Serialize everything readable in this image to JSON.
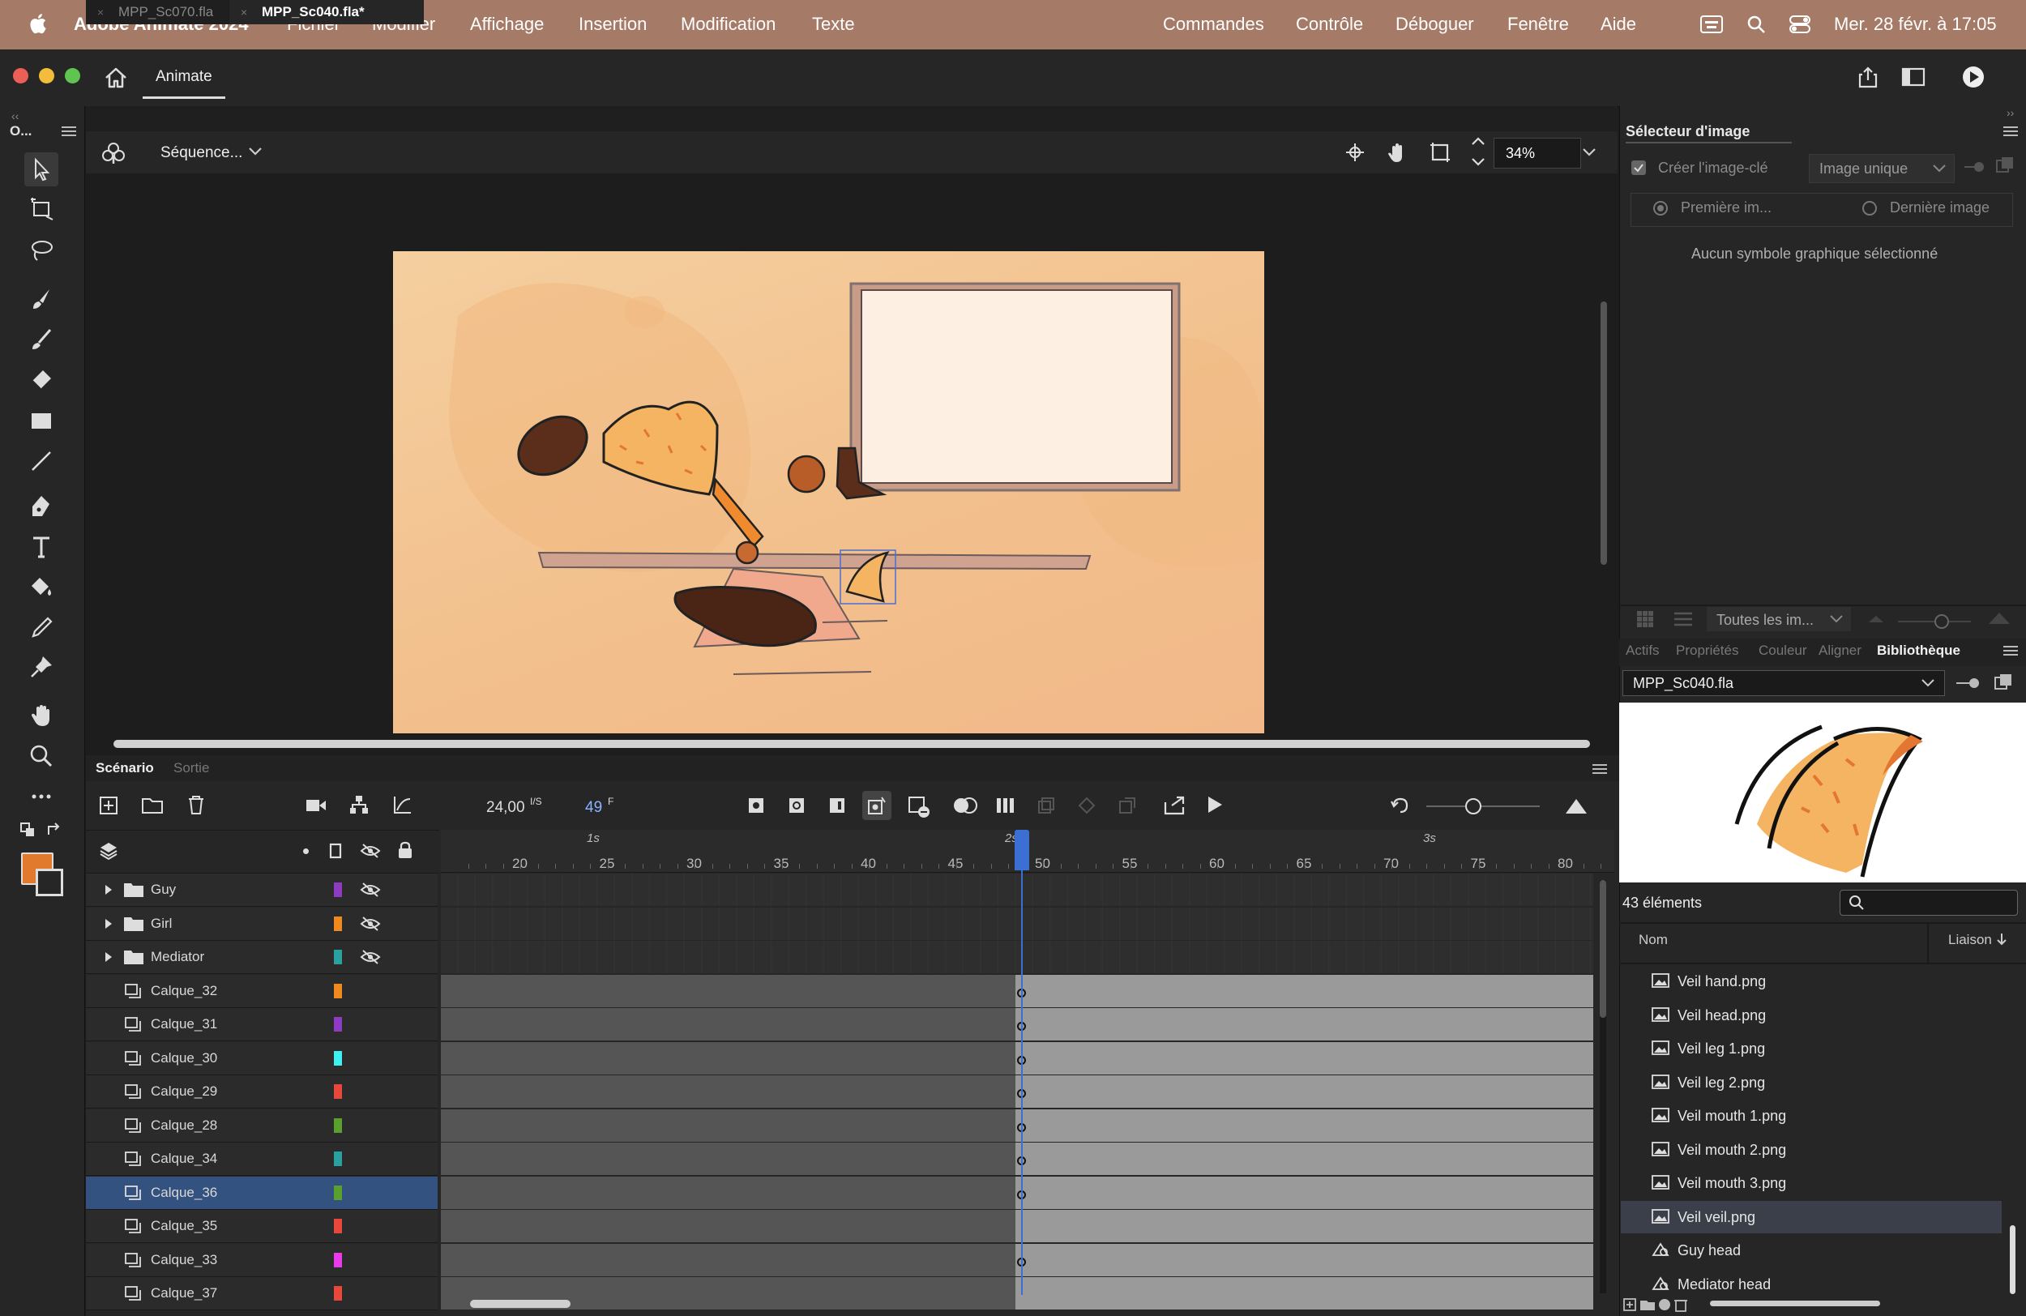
{
  "menubar": {
    "app_name": "Adobe Animate 2024",
    "items": [
      "Fichier",
      "Modifier",
      "Affichage",
      "Insertion",
      "Modification",
      "Texte",
      "Commandes",
      "Contrôle",
      "Déboguer",
      "Fenêtre",
      "Aide"
    ],
    "datetime": "Mer. 28 févr. à 17:05"
  },
  "appbar": {
    "tab_label": "Animate"
  },
  "toolbar": {
    "header": "O..."
  },
  "doc_tabs": [
    {
      "label": "MPP_Sc070.fla",
      "active": false
    },
    {
      "label": "MPP_Sc040.fla*",
      "active": true
    }
  ],
  "editbar": {
    "scene_label": "Séquence...",
    "zoom": "34%"
  },
  "frame_picker": {
    "title": "Sélecteur d'image",
    "create_keyframe": "Créer l'image-clé",
    "mode": "Image unique",
    "first_frame": "Première im...",
    "last_frame": "Dernière image",
    "empty_message": "Aucun symbole graphique sélectionné",
    "filter": "Toutes les im..."
  },
  "panel_tabs": [
    "Actifs",
    "Propriétés",
    "Couleur",
    "Aligner",
    "Bibliothèque"
  ],
  "library": {
    "file": "MPP_Sc040.fla",
    "count": "43 éléments",
    "col_name": "Nom",
    "col_link": "Liaison",
    "items": [
      {
        "label": "Veil hand.png",
        "type": "bitmap",
        "selected": false
      },
      {
        "label": "Veil head.png",
        "type": "bitmap",
        "selected": false
      },
      {
        "label": "Veil leg 1.png",
        "type": "bitmap",
        "selected": false
      },
      {
        "label": "Veil leg 2.png",
        "type": "bitmap",
        "selected": false
      },
      {
        "label": "Veil mouth 1.png",
        "type": "bitmap",
        "selected": false
      },
      {
        "label": "Veil mouth 2.png",
        "type": "bitmap",
        "selected": false
      },
      {
        "label": "Veil mouth 3.png",
        "type": "bitmap",
        "selected": false
      },
      {
        "label": "Veil veil.png",
        "type": "bitmap",
        "selected": true
      },
      {
        "label": "Guy head",
        "type": "graphic",
        "selected": false
      },
      {
        "label": "Mediator head",
        "type": "graphic",
        "selected": false
      }
    ]
  },
  "timeline": {
    "tabs": [
      "Scénario",
      "Sortie"
    ],
    "fps": "24,00",
    "fps_unit": "I/S",
    "current_frame": "49",
    "frame_unit": "F",
    "ruler_numbers": [
      "20",
      "25",
      "30",
      "35",
      "40",
      "45",
      "50",
      "55",
      "60",
      "65",
      "70",
      "75",
      "80"
    ],
    "second_marks": [
      "1s",
      "2s",
      "3s"
    ],
    "playhead_frame": 49,
    "layers": [
      {
        "name": "Guy",
        "kind": "folder",
        "color": "#8e3bc2",
        "selected": false,
        "key": false
      },
      {
        "name": "Girl",
        "kind": "folder",
        "color": "#f08a1e",
        "selected": false,
        "key": false
      },
      {
        "name": "Mediator",
        "kind": "folder",
        "color": "#2aa1a1",
        "selected": false,
        "key": false
      },
      {
        "name": "Calque_32",
        "kind": "layer",
        "color": "#f08a1e",
        "selected": false,
        "key": true
      },
      {
        "name": "Calque_31",
        "kind": "layer",
        "color": "#8e3bc2",
        "selected": false,
        "key": true
      },
      {
        "name": "Calque_30",
        "kind": "layer",
        "color": "#3ef0f0",
        "selected": false,
        "key": true
      },
      {
        "name": "Calque_29",
        "kind": "layer",
        "color": "#e8473c",
        "selected": false,
        "key": true
      },
      {
        "name": "Calque_28",
        "kind": "layer",
        "color": "#5aa02e",
        "selected": false,
        "key": true
      },
      {
        "name": "Calque_34",
        "kind": "layer",
        "color": "#2aa1a1",
        "selected": false,
        "key": true
      },
      {
        "name": "Calque_36",
        "kind": "layer",
        "color": "#5aa02e",
        "selected": true,
        "key": true
      },
      {
        "name": "Calque_35",
        "kind": "layer",
        "color": "#e8473c",
        "selected": false,
        "key": false
      },
      {
        "name": "Calque_33",
        "kind": "layer",
        "color": "#e83ce8",
        "selected": false,
        "key": true
      },
      {
        "name": "Calque_37",
        "kind": "layer",
        "color": "#e8473c",
        "selected": false,
        "key": false
      }
    ]
  }
}
